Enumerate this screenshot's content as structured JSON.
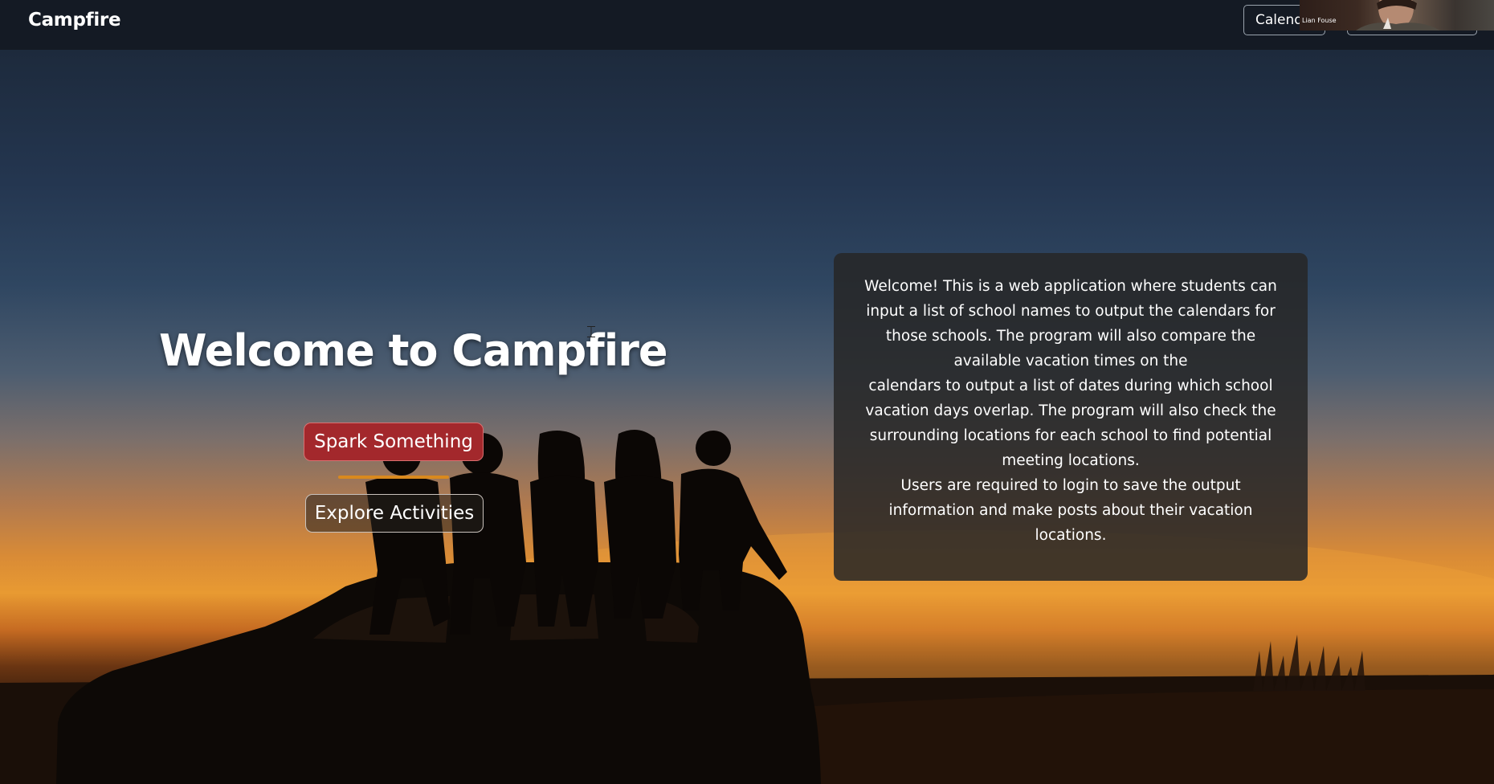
{
  "navbar": {
    "brand": "Campfire",
    "calendar_button": "Calend",
    "second_button": ""
  },
  "webcam_overlay": {
    "name": "Lian Fouse"
  },
  "hero": {
    "title": "Welcome to Campfire",
    "primary_button": "Spark Something",
    "secondary_button": "Explore Activities"
  },
  "info_card": {
    "paragraph_1_lines": [
      "Welcome! This is a web application where students can",
      "input a list of school names to output the calendars for",
      "those schools. The program will also compare the",
      "available vacation times on the",
      "calendars to output a list of dates during which school",
      "vacation days overlap. The program will also check the",
      "surrounding locations for each school to find potential",
      "meeting locations."
    ],
    "paragraph_2_lines": [
      "Users are required to login to save the output",
      "information and make posts about their vacation",
      "locations."
    ]
  },
  "colors": {
    "navbar_bg": "#141a24",
    "primary_button_bg": "#a3282c",
    "underline_accent": "#d9891e",
    "card_bg": "#262626"
  },
  "icons": {
    "cursor": "text-cursor-icon"
  }
}
